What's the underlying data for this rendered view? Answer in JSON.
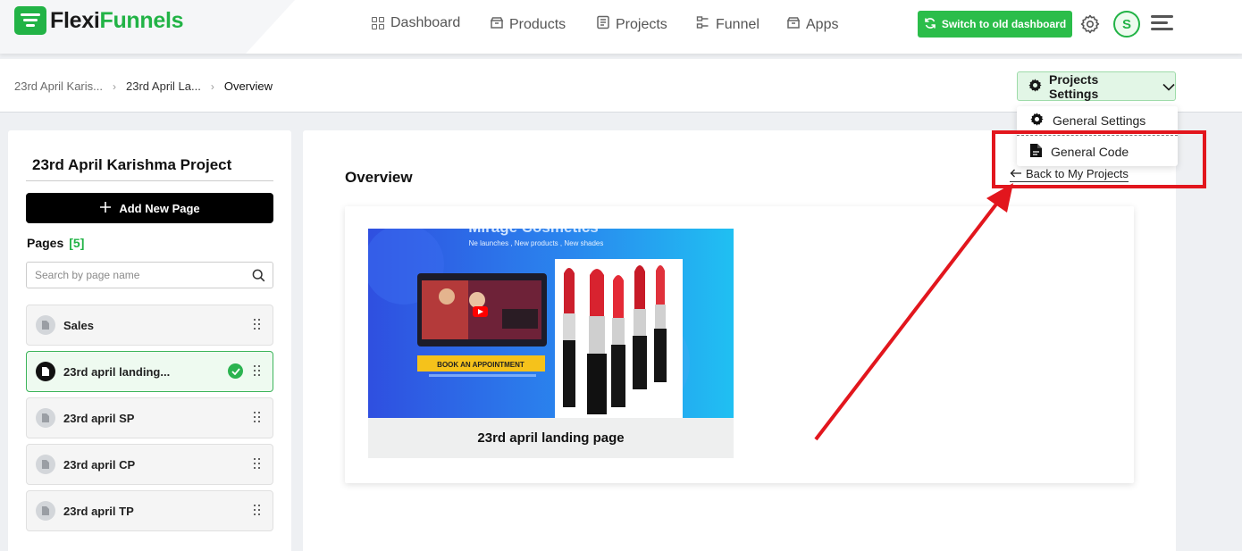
{
  "brand": {
    "name_part1": "Flexi",
    "name_part2": "Funnels"
  },
  "nav": {
    "items": [
      {
        "label": "Dashboard",
        "icon": "dashboard-icon"
      },
      {
        "label": "Products",
        "icon": "products-icon"
      },
      {
        "label": "Projects",
        "icon": "projects-icon"
      },
      {
        "label": "Funnel",
        "icon": "funnel-icon"
      },
      {
        "label": "Apps",
        "icon": "apps-icon"
      }
    ],
    "switch_label": "Switch to old dashboard",
    "avatar_initial": "S"
  },
  "breadcrumb": [
    "23rd April Karis...",
    "23rd April La...",
    "Overview"
  ],
  "project_settings": {
    "label": "Projects Settings",
    "menu": [
      {
        "label": "General Settings",
        "icon": "gear-icon"
      },
      {
        "label": "General Code",
        "icon": "document-icon"
      }
    ],
    "back_link": "Back to My Projects"
  },
  "sidebar": {
    "project_title": "23rd April Karishma Project",
    "add_page_label": "Add New Page",
    "pages_label": "Pages",
    "pages_count": "[5]",
    "search_placeholder": "Search by page name",
    "pages": [
      {
        "name": "Sales",
        "active": false
      },
      {
        "name": "23rd april landing...",
        "active": true
      },
      {
        "name": "23rd april SP",
        "active": false
      },
      {
        "name": "23rd april CP",
        "active": false
      },
      {
        "name": "23rd april TP",
        "active": false
      }
    ]
  },
  "main": {
    "title": "Overview",
    "card": {
      "caption": "23rd april landing page",
      "preview": {
        "headline": "Mirage Cosmetics",
        "subline": "Ne launches , New products , New shades",
        "cta": "BOOK AN APPOINTMENT"
      }
    }
  },
  "colors": {
    "brand_green": "#22b346",
    "annotation_red": "#e2161d",
    "active_page_bg": "#eefaf0"
  }
}
